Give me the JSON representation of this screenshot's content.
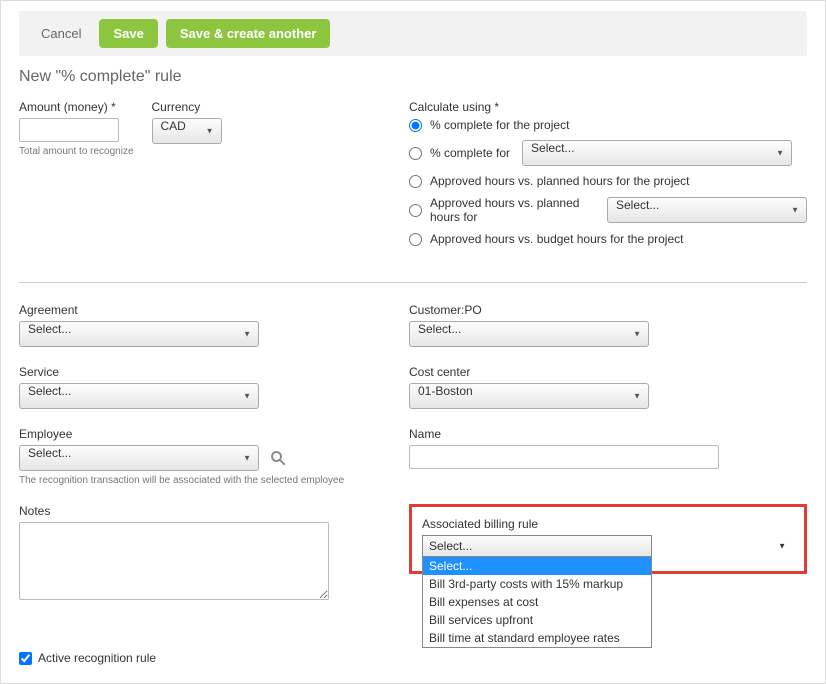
{
  "toolbar": {
    "cancel": "Cancel",
    "save": "Save",
    "save_create": "Save & create another"
  },
  "page_title": "New \"% complete\" rule",
  "amount": {
    "label": "Amount (money) *",
    "value": "",
    "helper": "Total amount to recognize"
  },
  "currency": {
    "label": "Currency",
    "selected": "CAD"
  },
  "calculate": {
    "label": "Calculate using *",
    "options": [
      {
        "label": "% complete for the project",
        "checked": true
      },
      {
        "label": "% complete for",
        "checked": false,
        "has_select": true,
        "select_value": "Select..."
      },
      {
        "label": "Approved hours vs. planned hours for the project",
        "checked": false
      },
      {
        "label": "Approved hours vs. planned hours for",
        "checked": false,
        "has_select": true,
        "select_value": "Select..."
      },
      {
        "label": "Approved hours vs. budget hours for the project",
        "checked": false
      }
    ]
  },
  "agreement": {
    "label": "Agreement",
    "value": "Select..."
  },
  "customer_po": {
    "label": "Customer:PO",
    "value": "Select..."
  },
  "service": {
    "label": "Service",
    "value": "Select..."
  },
  "cost_center": {
    "label": "Cost center",
    "value": "01-Boston"
  },
  "employee": {
    "label": "Employee",
    "value": "Select...",
    "helper": "The recognition transaction will be associated with the selected employee"
  },
  "name": {
    "label": "Name",
    "value": ""
  },
  "notes": {
    "label": "Notes",
    "value": ""
  },
  "assoc_billing": {
    "label": "Associated billing rule",
    "selected": "Select...",
    "options": [
      "Select...",
      "Bill 3rd-party costs with 15% markup",
      "Bill expenses at cost",
      "Bill services upfront",
      "Bill time at standard employee rates"
    ],
    "highlighted_index": 0
  },
  "active": {
    "label": "Active recognition rule",
    "checked": true
  }
}
